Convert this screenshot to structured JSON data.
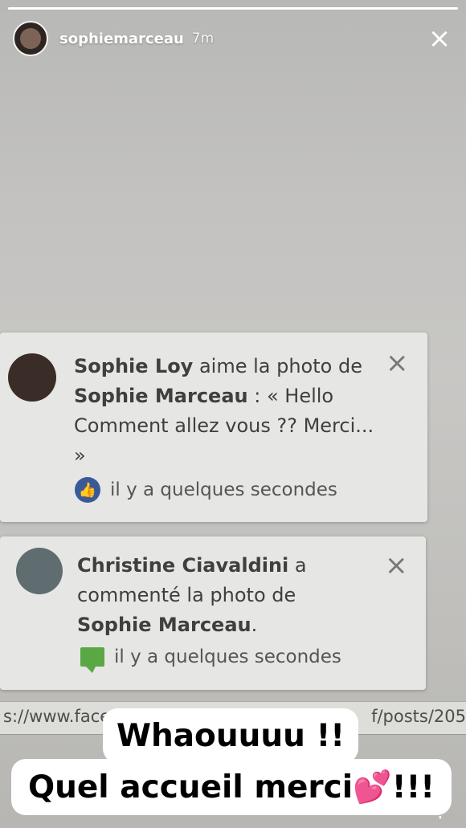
{
  "story": {
    "username": "sophiemarceau",
    "time": "7m",
    "progress_percent": 100
  },
  "notifications": [
    {
      "name": "Sophie Loy",
      "text_1": " aime la photo de",
      "page": "Sophie Marceau",
      "text_2": " : « Hello Comment allez vous ?? Merci... »",
      "meta_icon": "like-icon",
      "timestamp": "il y a quelques secondes"
    },
    {
      "name": "Christine Ciavaldini",
      "text_1": " a commenté la photo de",
      "page": "Sophie Marceau",
      "text_2": ".",
      "meta_icon": "comment-icon",
      "timestamp": "il y a quelques secondes"
    }
  ],
  "url_bar": {
    "left": "s://www.face",
    "right": "f/posts/205"
  },
  "captions": {
    "line_1": "Whaouuuu !!",
    "line_2": "Quel accueil merci💕!!!"
  }
}
